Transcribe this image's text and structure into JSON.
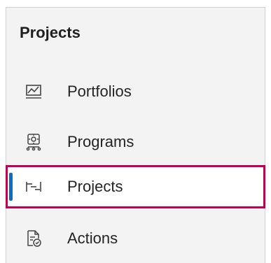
{
  "section": {
    "title": "Projects"
  },
  "nav": {
    "items": [
      {
        "label": "Portfolios",
        "icon": "portfolio-chart-icon",
        "selected": false
      },
      {
        "label": "Programs",
        "icon": "program-hierarchy-icon",
        "selected": false
      },
      {
        "label": "Projects",
        "icon": "project-timeline-icon",
        "selected": true
      },
      {
        "label": "Actions",
        "icon": "actions-document-icon",
        "selected": false
      }
    ]
  },
  "colors": {
    "selected_border": "#c30052",
    "selected_accent": "#0f6cbd",
    "panel_background": "#f3f3f3"
  }
}
